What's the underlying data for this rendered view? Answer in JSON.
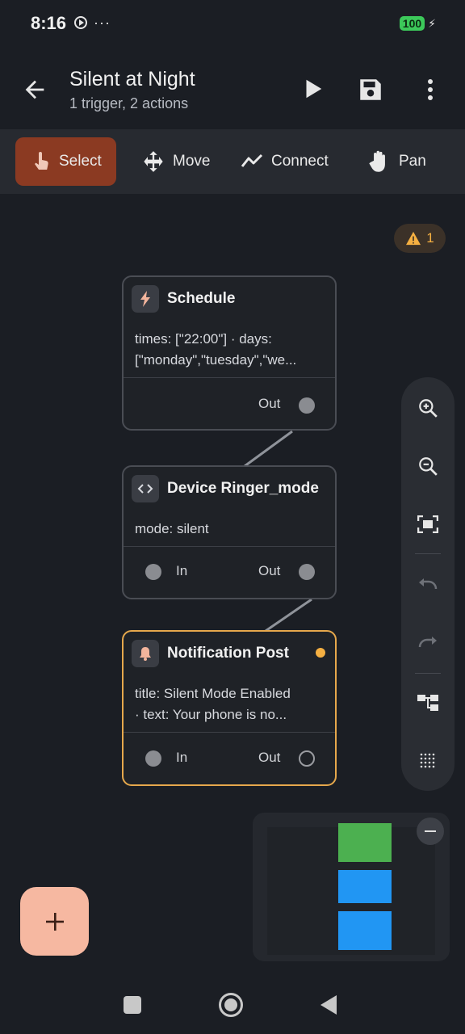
{
  "status": {
    "time": "8:16",
    "more": "···",
    "battery": "100"
  },
  "header": {
    "title": "Silent at Night",
    "subtitle": "1 trigger, 2 actions"
  },
  "toolbar": {
    "tools": [
      {
        "label": "Select",
        "icon": "tap-icon",
        "active": true
      },
      {
        "label": "Move",
        "icon": "move-icon"
      },
      {
        "label": "Connect",
        "icon": "connect-icon"
      },
      {
        "label": "Pan",
        "icon": "hand-icon"
      }
    ]
  },
  "warning": {
    "count": "1",
    "color": "#f5b042"
  },
  "nodes": [
    {
      "title": "Schedule",
      "icon": "bolt-icon",
      "body_line1": "times: [\"22:00\"]  ·  days:",
      "body_line2": "[\"monday\",\"tuesday\",\"we...",
      "out_label": "Out"
    },
    {
      "title": "Device Ringer_mode",
      "icon": "code-icon",
      "body_line1": "mode: silent",
      "in_label": "In",
      "out_label": "Out"
    },
    {
      "title": "Notification Post",
      "icon": "bell-icon",
      "body_line1": "title: Silent Mode Enabled",
      "body_line2": " ·  text: Your phone is no...",
      "in_label": "In",
      "out_label": "Out",
      "selected": true,
      "accent": "#e6a84c"
    }
  ],
  "controls": [
    "zoom-in-icon",
    "zoom-out-icon",
    "fit-screen-icon",
    "undo-icon",
    "redo-icon",
    "auto-layout-icon",
    "grid-icon"
  ],
  "minimap": {
    "colors": [
      "#4cb050",
      "#2196f3",
      "#2196f3"
    ]
  },
  "fab": {
    "label": "+",
    "color": "#f6b8a1"
  },
  "colors": {
    "background": "#1b1e24",
    "toolbar": "#272a30",
    "select_active": "#8b3a22"
  }
}
